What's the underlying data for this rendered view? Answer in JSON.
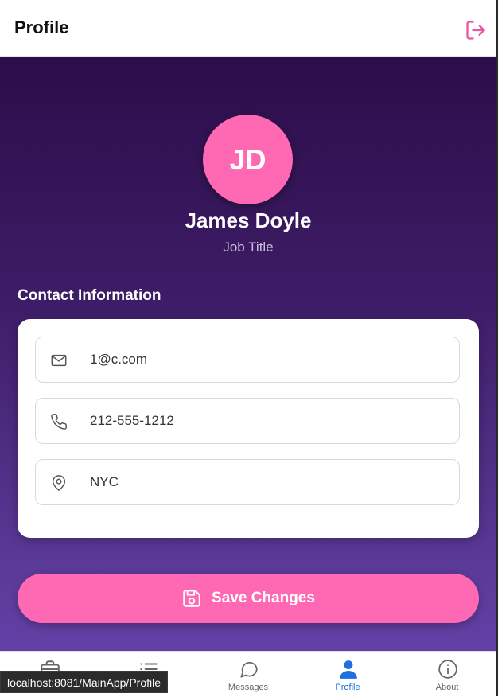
{
  "header": {
    "title": "Profile",
    "logout_icon": "logout-icon"
  },
  "profile": {
    "initials": "JD",
    "name": "James Doyle",
    "job_title": "Job Title",
    "avatar_color": "#ff69b4"
  },
  "contact": {
    "section_title": "Contact Information",
    "email": "1@c.com",
    "phone": "212-555-1212",
    "location": "NYC"
  },
  "actions": {
    "save_label": "Save Changes",
    "save_icon": "floppy-disk-icon"
  },
  "tabs": [
    {
      "label": "",
      "icon": "briefcase-icon"
    },
    {
      "label": "",
      "icon": "list-icon"
    },
    {
      "label": "Messages",
      "icon": "chat-bubble-icon"
    },
    {
      "label": "Profile",
      "icon": "person-icon",
      "active": true
    },
    {
      "label": "About",
      "icon": "info-icon"
    }
  ],
  "status_bar": {
    "url": "localhost:8081/MainApp/Profile"
  },
  "colors": {
    "accent_pink": "#ff69b4",
    "gradient_top": "#2c0d49",
    "gradient_bottom": "#6340a6",
    "active_tab": "#1e6fe0"
  }
}
